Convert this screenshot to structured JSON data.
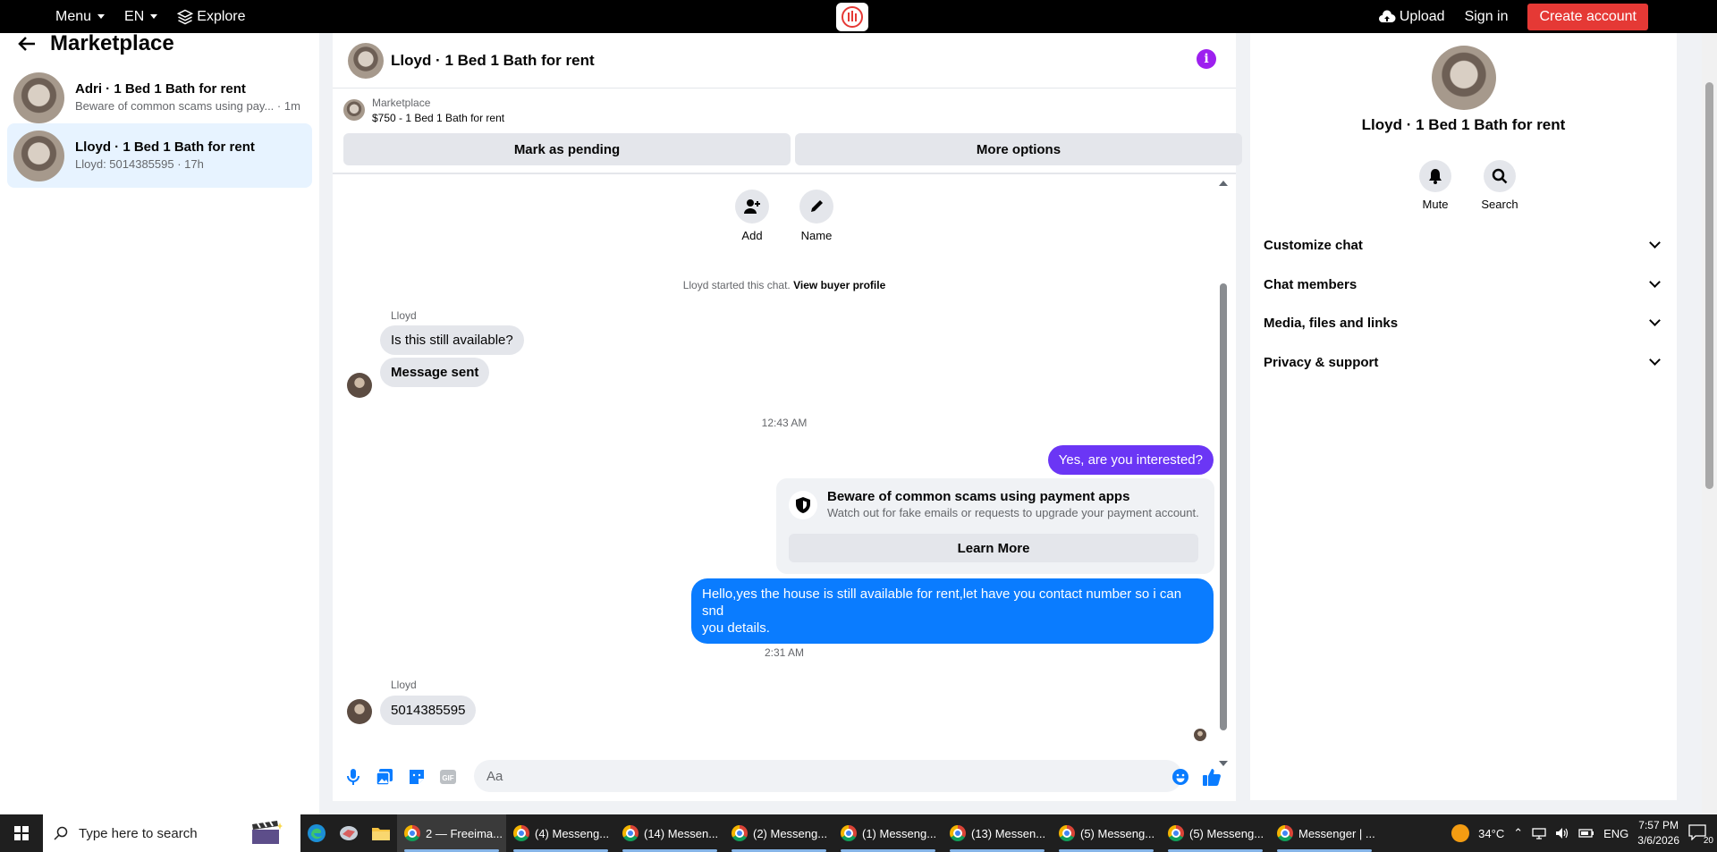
{
  "topbar": {
    "menu_label": "Menu",
    "lang_label": "EN",
    "explore_label": "Explore",
    "upload_label": "Upload",
    "signin_label": "Sign in",
    "create_label": "Create account"
  },
  "sidebar": {
    "title": "Marketplace",
    "conversations": [
      {
        "title": "Adri · 1 Bed 1 Bath for rent",
        "snippet": "Beware of common scams using pay...",
        "time": "· 1m"
      },
      {
        "title": "Lloyd · 1 Bed 1 Bath for rent",
        "snippet": "Lloyd: 5014385595",
        "time": "· 17h"
      }
    ]
  },
  "chat": {
    "title": "Lloyd · 1 Bed 1 Bath for rent",
    "marketplace_label": "Marketplace",
    "listing": "$750 - 1 Bed 1 Bath for rent",
    "mark_pending_label": "Mark as pending",
    "more_options_label": "More options",
    "add_label": "Add",
    "name_label": "Name",
    "notice_text": "Lloyd started this chat.",
    "notice_link": "View buyer profile",
    "sender1": "Lloyd",
    "msg1": "Is this still available?",
    "msg2": "Message sent",
    "time1": "12:43 AM",
    "msg3": "Yes, are you interested?",
    "scam_title": "Beware of common scams using payment apps",
    "scam_sub": "Watch out for fake emails or requests to upgrade your payment account.",
    "scam_btn": "Learn More",
    "msg4_line1": "Hello,yes the house is still available for rent,let have you contact number so i can snd",
    "msg4_line2": "you details.",
    "time2": "2:31 AM",
    "sender2": "Lloyd",
    "msg5": "5014385595",
    "composer_placeholder": "Aa"
  },
  "details": {
    "title": "Lloyd · 1 Bed 1 Bath for rent",
    "mute_label": "Mute",
    "search_label": "Search",
    "sections": [
      "Customize chat",
      "Chat members",
      "Media, files and links",
      "Privacy & support"
    ]
  },
  "taskbar": {
    "search_placeholder": "Type here to search",
    "tasks": [
      "2 — Freeima...",
      "(4) Messeng...",
      "(14) Messen...",
      "(2) Messeng...",
      "(1) Messeng...",
      "(13) Messen...",
      "(5) Messeng...",
      "(5) Messeng...",
      "Messenger | ..."
    ],
    "weather": "34°C",
    "lang": "ENG",
    "time": "7:57 PM",
    "date": "3/6/2026",
    "notif_count": "20"
  },
  "colors": {
    "accent_red": "#e53935",
    "bubble_blue": "#0a7cff",
    "bubble_purple": "#6b36f5",
    "info_purple": "#9d20ef"
  }
}
